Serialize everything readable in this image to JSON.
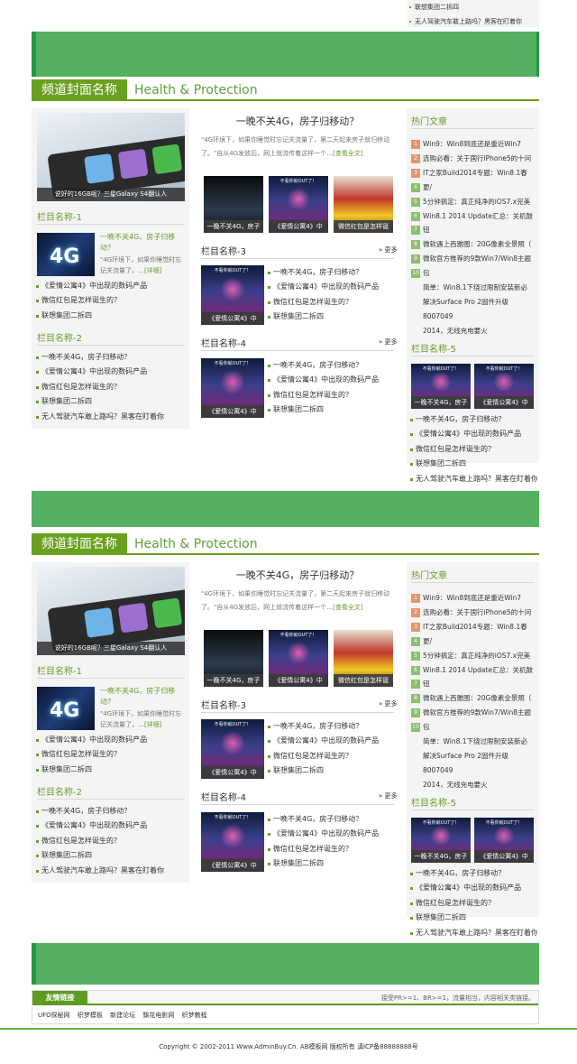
{
  "top_fragment": [
    "联想集团二拆四",
    "无人驾驶汽车敢上路吗？黑客在盯着你"
  ],
  "banner_colors": {
    "fill": "#55b061",
    "edge": "#1f9a43"
  },
  "sections": [
    {
      "channel_name": "频道封面名称",
      "channel_sub": "Health & Protection",
      "slide_caption": "说好的16GB呢？三星Galaxy S4翻认人",
      "col1": {
        "cat1_title": "栏目名称-1",
        "feature_title": "一晚不关4G，房子归移动？",
        "feature_desc": "\"4G环境下，如果你睡觉时忘记关流量了，…",
        "feature_more": "[详细]",
        "cat1_items": [
          "《爱情公寓4》中出现的数码产品",
          "微信红包是怎样诞生的？",
          "联想集团二拆四"
        ],
        "cat2_title": "栏目名称-2",
        "cat2_items": [
          "一晚不关4G，房子归移动？",
          "《爱情公寓4》中出现的数码产品",
          "微信红包是怎样诞生的？",
          "联想集团二拆四",
          "无人驾驶汽车敢上路吗？黑客在盯着你"
        ]
      },
      "col2": {
        "headline": "一晚不关4G，房子归移动？",
        "summary": "\"4G环境下，如果你睡觉时忘记关流量了，第二天起来房子就归移动了。\"自从4G发放后，网上就流传着这样一个…",
        "summary_more": "[查看全文]",
        "photo_caps": [
          "一晚不关4G，房子",
          "《爱情公寓4》中",
          "微信红包是怎样诞"
        ],
        "cat3_title": "栏目名称-3",
        "cat4_title": "栏目名称-4",
        "more_label": "更多",
        "thumb_top": "不看你就OUT了！",
        "thumb_bottom": "818数码公寓4中的",
        "thumb_cap": "《爱情公寓4》中",
        "cat3_items": [
          "一晚不关4G，房子归移动？",
          "《爱情公寓4》中出现的数码产品",
          "微信红包是怎样诞生的？",
          "联想集团二拆四"
        ],
        "cat4_items": [
          "一晚不关4G，房子归移动？",
          "《爱情公寓4》中出现的数码产品",
          "微信红包是怎样诞生的？",
          "联想集团二拆四"
        ]
      },
      "col3": {
        "hot_title": "热门文章",
        "hot_items": [
          {
            "num": "1",
            "text": "Win9：Win8到底还是重近Win7"
          },
          {
            "num": "2",
            "text": "选购必看：关于国行iPhone5的十问"
          },
          {
            "num": "3",
            "text": "IT之家Build2014专题：Win8.1春"
          },
          {
            "num": "4",
            "text": "更/"
          },
          {
            "num": "5",
            "text": "5分钟搞定：真正纯净的iOS7.x完美"
          },
          {
            "num": "6",
            "text": "Win8.1 2014 Update汇总：关机鼓"
          },
          {
            "num": "7",
            "text": "钮"
          },
          {
            "num": "8",
            "text": "微软遇上西雅图：20G像素全景照（"
          },
          {
            "num": "9",
            "text": "微软官方推荐的9款Win7/Win8主题"
          },
          {
            "num": "10",
            "text": "包"
          },
          {
            "num": "",
            "text": "简单：Win8.1下绕过限制安装新必"
          },
          {
            "num": "",
            "text": "解决Surface Pro 2固件升级"
          },
          {
            "num": "",
            "text": "8007049"
          },
          {
            "num": "",
            "text": "2014，无线充电要火"
          }
        ],
        "cat5_title": "栏目名称-5",
        "thumb_caps": [
          "一晚不关4G，房子",
          "《爱情公寓4》中"
        ],
        "cat5_items": [
          "一晚不关4G，房子归移动？",
          "《爱情公寓4》中出现的数码产品",
          "微信红包是怎样诞生的？",
          "联想集团二拆四",
          "无人驾驶汽车敢上路吗？黑客在盯着你"
        ]
      }
    },
    {
      "channel_name": "频道封面名称",
      "channel_sub": "Health & Protection",
      "slide_caption": "说好的16GB呢？三星Galaxy S4翻认人",
      "col1": {
        "cat1_title": "栏目名称-1",
        "feature_title": "一晚不关4G，房子归移动？",
        "feature_desc": "\"4G环境下，如果你睡觉时忘记关流量了，…",
        "feature_more": "[详细]",
        "cat1_items": [
          "《爱情公寓4》中出现的数码产品",
          "微信红包是怎样诞生的？",
          "联想集团二拆四"
        ],
        "cat2_title": "栏目名称-2",
        "cat2_items": [
          "一晚不关4G，房子归移动？",
          "《爱情公寓4》中出现的数码产品",
          "微信红包是怎样诞生的？",
          "联想集团二拆四",
          "无人驾驶汽车敢上路吗？黑客在盯着你"
        ]
      },
      "col2": {
        "headline": "一晚不关4G，房子归移动？",
        "summary": "\"4G环境下，如果你睡觉时忘记关流量了，第二天起来房子就归移动了。\"自从4G发放后，网上就流传着这样一个…",
        "summary_more": "[查看全文]",
        "photo_caps": [
          "一晚不关4G，房子",
          "《爱情公寓4》中",
          "微信红包是怎样诞"
        ],
        "cat3_title": "栏目名称-3",
        "cat4_title": "栏目名称-4",
        "more_label": "更多",
        "thumb_top": "不看你就OUT了！",
        "thumb_bottom": "818数码公寓4中的",
        "thumb_cap": "《爱情公寓4》中",
        "cat3_items": [
          "一晚不关4G，房子归移动？",
          "《爱情公寓4》中出现的数码产品",
          "微信红包是怎样诞生的？",
          "联想集团二拆四"
        ],
        "cat4_items": [
          "一晚不关4G，房子归移动？",
          "《爱情公寓4》中出现的数码产品",
          "微信红包是怎样诞生的？",
          "联想集团二拆四"
        ]
      },
      "col3": {
        "hot_title": "热门文章",
        "hot_items": [
          {
            "num": "1",
            "text": "Win9：Win8到底还是重近Win7"
          },
          {
            "num": "2",
            "text": "选购必看：关于国行iPhone5的十问"
          },
          {
            "num": "3",
            "text": "IT之家Build2014专题：Win8.1春"
          },
          {
            "num": "4",
            "text": "更/"
          },
          {
            "num": "5",
            "text": "5分钟搞定：真正纯净的iOS7.x完美"
          },
          {
            "num": "6",
            "text": "Win8.1 2014 Update汇总：关机鼓"
          },
          {
            "num": "7",
            "text": "钮"
          },
          {
            "num": "8",
            "text": "微软遇上西雅图：20G像素全景照（"
          },
          {
            "num": "9",
            "text": "微软官方推荐的9款Win7/Win8主题"
          },
          {
            "num": "10",
            "text": "包"
          },
          {
            "num": "",
            "text": "简单：Win8.1下绕过限制安装新必"
          },
          {
            "num": "",
            "text": "解决Surface Pro 2固件升级"
          },
          {
            "num": "",
            "text": "8007049"
          },
          {
            "num": "",
            "text": "2014，无线充电要火"
          }
        ],
        "cat5_title": "栏目名称-5",
        "thumb_caps": [
          "一晚不关4G，房子",
          "《爱情公寓4》中"
        ],
        "cat5_items": [
          "一晚不关4G，房子归移动？",
          "《爱情公寓4》中出现的数码产品",
          "微信红包是怎样诞生的？",
          "联想集团二拆四",
          "无人驾驶汽车敢上路吗？黑客在盯着你"
        ]
      }
    }
  ],
  "friend": {
    "tab_label": "友情链接",
    "note": "接受PR>=1、BR>=1，流量相当，内容相关类链接。",
    "links": [
      "UFO探秘网",
      "织梦模板",
      "新建论坛",
      "飘花电影网",
      "织梦教程"
    ]
  },
  "copyright": "Copyright © 2002-2011 Www.AdminBuy.Cn. AB模板网 版权所有 滇ICP备88888888号",
  "hot_num_colors": {
    "top": "#e8946b",
    "rest": "#8cc06a"
  }
}
